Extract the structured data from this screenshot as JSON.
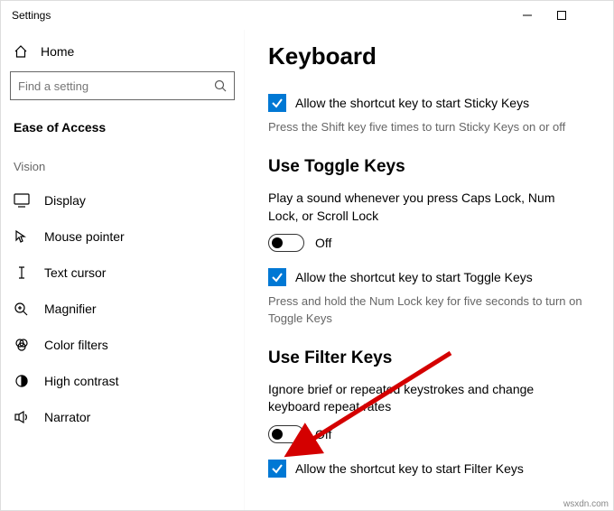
{
  "window": {
    "title": "Settings"
  },
  "sidebar": {
    "home": "Home",
    "search_placeholder": "Find a setting",
    "group": "Ease of Access",
    "category": "Vision",
    "items": [
      {
        "label": "Display"
      },
      {
        "label": "Mouse pointer"
      },
      {
        "label": "Text cursor"
      },
      {
        "label": "Magnifier"
      },
      {
        "label": "Color filters"
      },
      {
        "label": "High contrast"
      },
      {
        "label": "Narrator"
      }
    ]
  },
  "content": {
    "title": "Keyboard",
    "sticky": {
      "checkbox": "Allow the shortcut key to start Sticky Keys",
      "hint": "Press the Shift key five times to turn Sticky Keys on or off"
    },
    "toggle_section": {
      "heading": "Use Toggle Keys",
      "desc": "Play a sound whenever you press Caps Lock, Num Lock, or Scroll Lock",
      "state": "Off",
      "checkbox": "Allow the shortcut key to start Toggle Keys",
      "hint": "Press and hold the Num Lock key for five seconds to turn on Toggle Keys"
    },
    "filter_section": {
      "heading": "Use Filter Keys",
      "desc": "Ignore brief or repeated keystrokes and change keyboard repeat rates",
      "state": "Off",
      "checkbox": "Allow the shortcut key to start Filter Keys"
    }
  },
  "footer": "wsxdn.com"
}
